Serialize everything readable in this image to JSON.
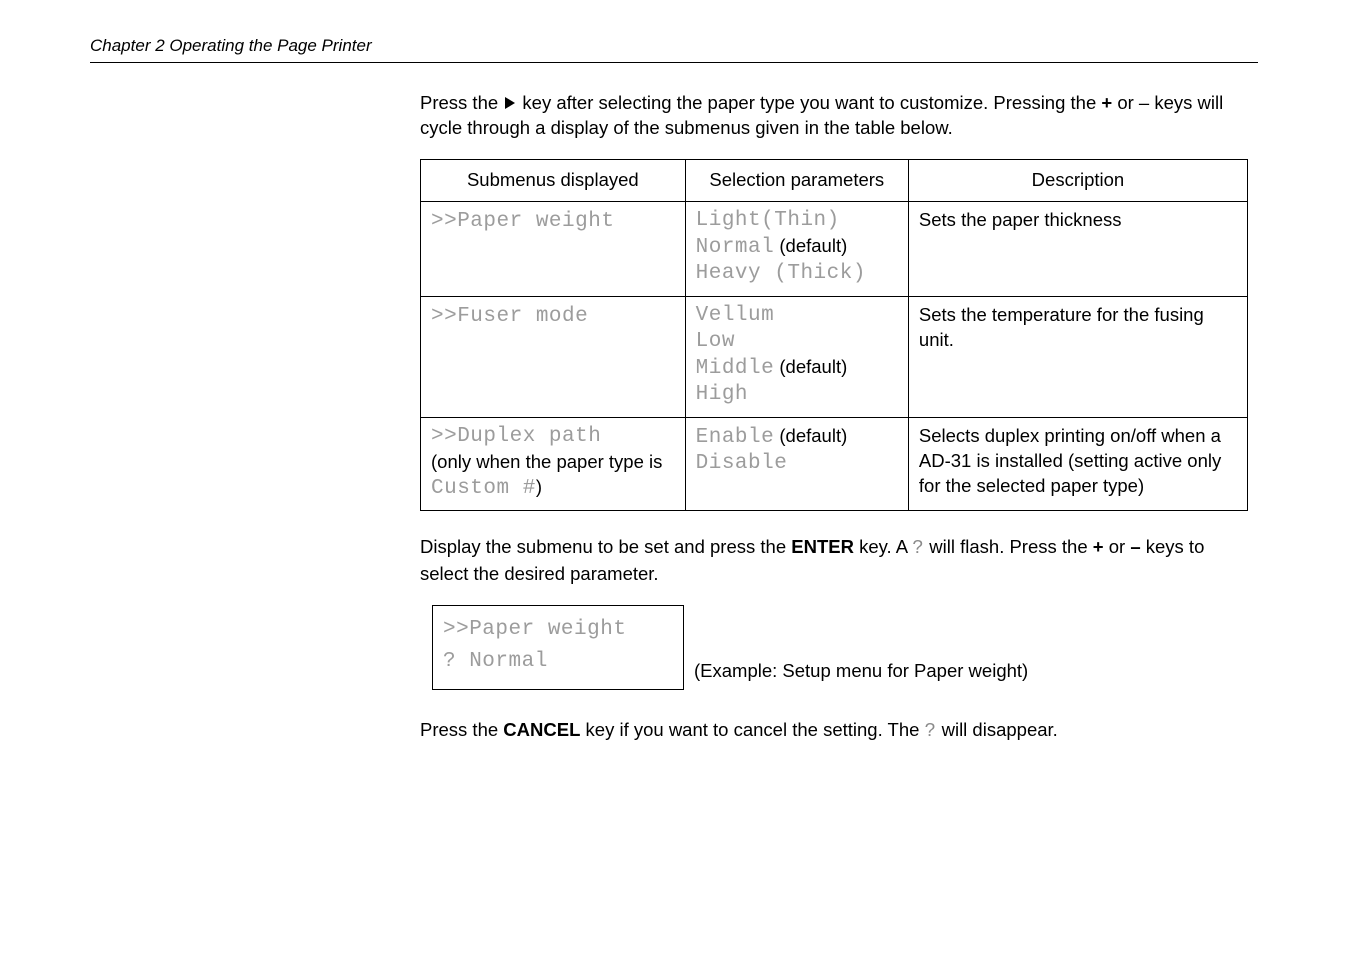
{
  "chapter": "Chapter 2  Operating the Page Printer",
  "intro_1a": "Press the  ",
  "intro_1b": "  key after selecting the paper type you want to customize. Pressing the ",
  "intro_plus": "+",
  "intro_1c": " or – keys will cycle through a display of the submenus given in the table below.",
  "headers": {
    "c1": "Submenus displayed",
    "c2": "Selection parameters",
    "c3": "Description"
  },
  "rows": [
    {
      "submenu": ">>Paper weight",
      "params": [
        {
          "text": "Light(Thin)",
          "default": false
        },
        {
          "text": "Normal",
          "default": true
        },
        {
          "text": "Heavy (Thick)",
          "default": false
        }
      ],
      "desc": "Sets the paper thickness"
    },
    {
      "submenu": ">>Fuser mode",
      "params": [
        {
          "text": "Vellum",
          "default": false
        },
        {
          "text": "Low",
          "default": false
        },
        {
          "text": "Middle",
          "default": true
        },
        {
          "text": "High",
          "default": false
        }
      ],
      "desc": "Sets the temperature for the fusing unit."
    },
    {
      "submenu": ">>Duplex path",
      "subnote_a": "(only when the paper type is ",
      "subnote_lcd": "Custom #",
      "subnote_b": ")",
      "params": [
        {
          "text": "Enable",
          "default": true
        },
        {
          "text": "Disable",
          "default": false
        }
      ],
      "desc": "Selects duplex printing on/off when a AD-31 is installed (setting active only for the selected paper type)"
    }
  ],
  "mid_a": "Display the submenu to be set and press the ",
  "mid_enter": "ENTER",
  "mid_b": " key. A ",
  "mid_q": "?",
  "mid_c": "  will flash. Press the ",
  "mid_plus": "+",
  "mid_d": " or ",
  "mid_minus": "–",
  "mid_e": " keys to select the desired parameter.",
  "box_line1": ">>Paper weight",
  "box_line2": "? Normal",
  "example_caption": "(Example: Setup menu for Paper weight)",
  "last_a": "Press the ",
  "last_cancel": "CANCEL",
  "last_b": " key if you want to cancel the setting. The ",
  "last_q": "?",
  "last_c": " will disappear."
}
